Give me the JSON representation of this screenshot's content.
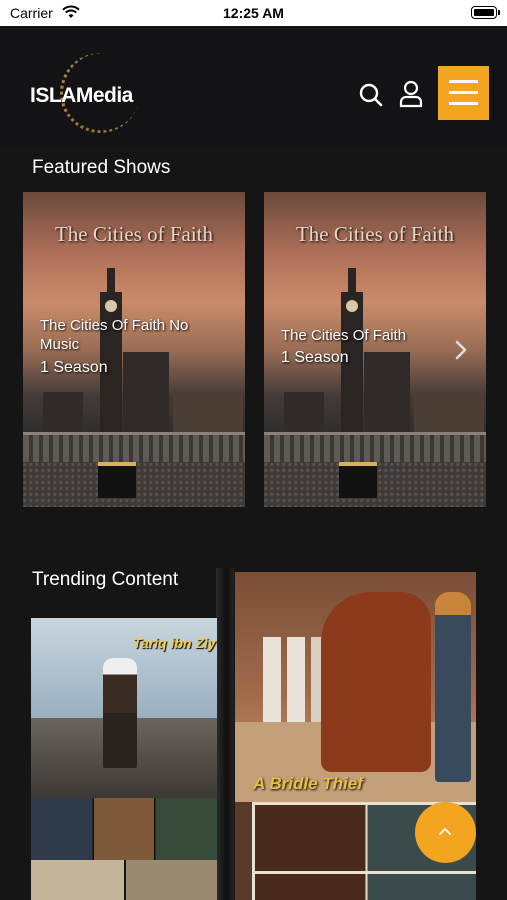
{
  "status_bar": {
    "carrier": "Carrier",
    "time": "12:25 AM",
    "wifi_icon": "wifi-icon",
    "battery_icon": "battery-icon"
  },
  "header": {
    "logo_text": "ISLAMedia",
    "search_icon": "search-icon",
    "user_icon": "user-icon",
    "menu_icon": "menu-icon",
    "accent_color": "#f4a51f"
  },
  "featured": {
    "title": "Featured Shows",
    "shows": [
      {
        "art_title": "The Cities of Faith",
        "title": "The Cities Of Faith No Music",
        "seasons": "1 Season"
      },
      {
        "art_title": "The Cities of Faith",
        "title": "The Cities Of Faith",
        "seasons": "1 Season"
      }
    ],
    "next_icon": "chevron-right-icon"
  },
  "trending": {
    "title": "Trending Content",
    "items": [
      {
        "art_title": "Tariq ibn Ziy"
      },
      {
        "art_title": "A Bridle Thief"
      }
    ]
  },
  "scroll_top": {
    "icon": "chevron-up-icon"
  }
}
